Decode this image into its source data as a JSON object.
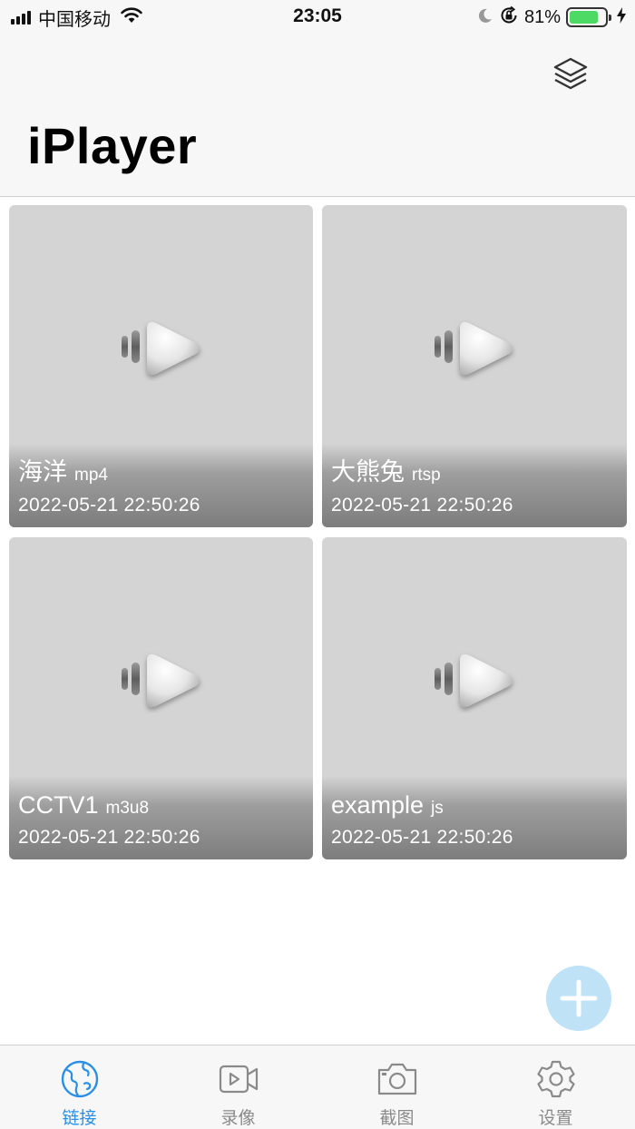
{
  "status_bar": {
    "carrier": "中国移动",
    "time": "23:05",
    "battery_percent": "81%",
    "battery_level": 0.81,
    "icons": [
      "signal-icon",
      "wifi-icon",
      "moon-icon",
      "orientation-lock-icon",
      "battery-icon",
      "charging-icon"
    ]
  },
  "header": {
    "title": "iPlayer",
    "action_icon": "layers-icon"
  },
  "cards": [
    {
      "name": "海洋",
      "type": "mp4",
      "date": "2022-05-21 22:50:26"
    },
    {
      "name": "大熊兔",
      "type": "rtsp",
      "date": "2022-05-21 22:50:26"
    },
    {
      "name": "CCTV1",
      "type": "m3u8",
      "date": "2022-05-21 22:50:26"
    },
    {
      "name": "example",
      "type": "js",
      "date": "2022-05-21 22:50:26"
    }
  ],
  "fab": {
    "icon": "plus-icon"
  },
  "tab_bar": {
    "active_color": "#2b8fe5",
    "items": [
      {
        "label": "链接",
        "icon": "globe-icon",
        "active": true
      },
      {
        "label": "录像",
        "icon": "video-icon",
        "active": false
      },
      {
        "label": "截图",
        "icon": "camera-icon",
        "active": false
      },
      {
        "label": "设置",
        "icon": "gear-icon",
        "active": false
      }
    ]
  }
}
